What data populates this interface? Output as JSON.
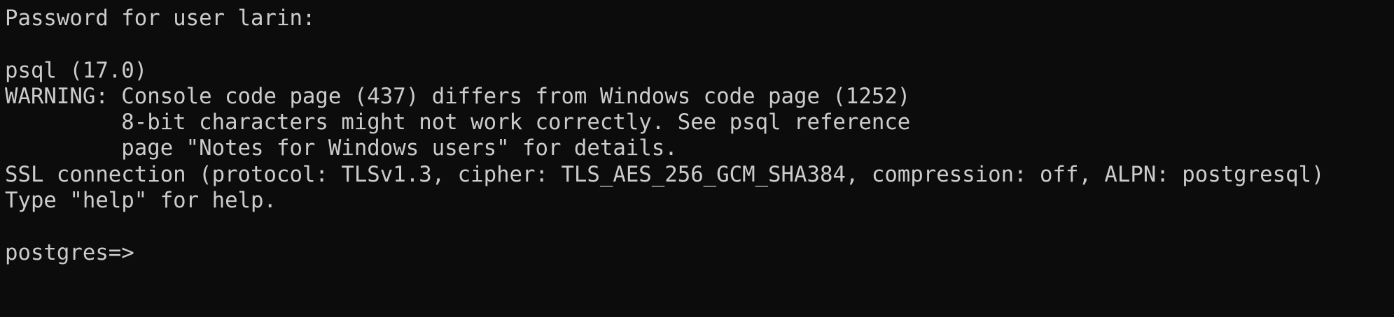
{
  "terminal": {
    "colors": {
      "background": "#0c0c0c",
      "foreground": "#cccccc"
    },
    "lines": [
      "Password for user larin:",
      "",
      "psql (17.0)",
      "WARNING: Console code page (437) differs from Windows code page (1252)",
      "         8-bit characters might not work correctly. See psql reference",
      "         page \"Notes for Windows users\" for details.",
      "SSL connection (protocol: TLSv1.3, cipher: TLS_AES_256_GCM_SHA384, compression: off, ALPN: postgresql)",
      "Type \"help\" for help.",
      ""
    ],
    "prompt": "postgres=>",
    "input_value": ""
  }
}
